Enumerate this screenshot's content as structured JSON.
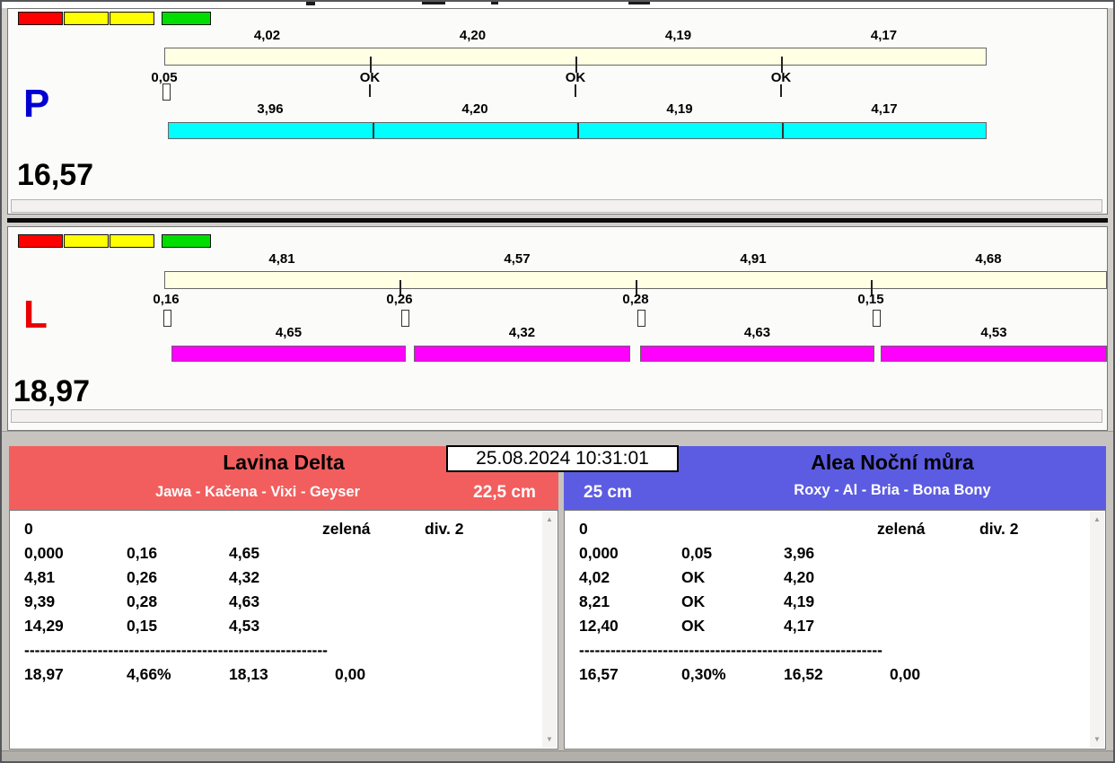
{
  "datetime": "25.08.2024 10:31:01",
  "panels": {
    "p": {
      "letter": "P",
      "letter_color": "#0000d0",
      "lights": [
        "#ff0000",
        "#ffff00",
        "#ffff00",
        "#00dd00"
      ],
      "upper_bar_color": "#ffffe3",
      "lower_bar_color": "#00ffff",
      "upper_splits": [
        "4,02",
        "4,20",
        "4,19",
        "4,17"
      ],
      "start_mark": "0,05",
      "gate_marks": [
        "OK",
        "OK",
        "OK"
      ],
      "lower_splits": [
        "3,96",
        "4,20",
        "4,19",
        "4,17"
      ],
      "total": "16,57"
    },
    "l": {
      "letter": "L",
      "letter_color": "#e80000",
      "lights": [
        "#ff0000",
        "#ffff00",
        "#ffff00",
        "#00dd00"
      ],
      "upper_bar_color": "#ffffe3",
      "lower_bar_color": "#ff00ff",
      "upper_splits": [
        "4,81",
        "4,57",
        "4,91",
        "4,68"
      ],
      "gate_marks": [
        "0,16",
        "0,26",
        "0,28",
        "0,15"
      ],
      "lower_splits": [
        "4,65",
        "4,32",
        "4,63",
        "4,53"
      ],
      "total": "18,97"
    }
  },
  "teams": {
    "left": {
      "name": "Lavina Delta",
      "members": "Jawa - Kačena - Vixi - Geyser",
      "height": "22,5 cm",
      "accent": "#f25e5e",
      "log": {
        "head": [
          "0",
          "zelená",
          "div. 2"
        ],
        "rows": [
          [
            "0,000",
            "0,16",
            "4,65"
          ],
          [
            "4,81",
            "0,26",
            "4,32"
          ],
          [
            "9,39",
            "0,28",
            "4,63"
          ],
          [
            "14,29",
            "0,15",
            "4,53"
          ]
        ],
        "divider": "----------------------------------------------------------",
        "total": [
          "18,97",
          "4,66%",
          "18,13",
          "0,00"
        ]
      }
    },
    "right": {
      "name": "Alea Noční můra",
      "members": "Roxy - Al - Bria - Bona Bony",
      "height": "25 cm",
      "accent": "#5c5ce2",
      "log": {
        "head": [
          "0",
          "zelená",
          "div. 2"
        ],
        "rows": [
          [
            "0,000",
            "0,05",
            "3,96"
          ],
          [
            "4,02",
            "OK",
            "4,20"
          ],
          [
            "8,21",
            "OK",
            "4,19"
          ],
          [
            "12,40",
            "OK",
            "4,17"
          ]
        ],
        "divider": "----------------------------------------------------------",
        "total": [
          "16,57",
          "0,30%",
          "16,52",
          "0,00"
        ]
      }
    }
  }
}
